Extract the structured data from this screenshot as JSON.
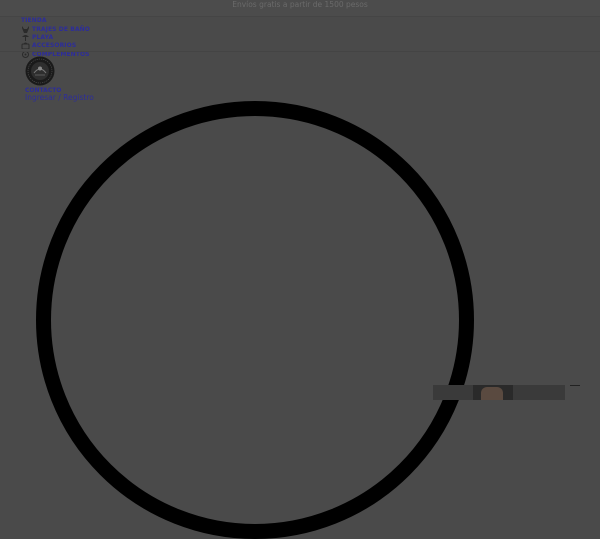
{
  "banner": {
    "text": "Envíos gratis a partir de 1500 pesos"
  },
  "nav": {
    "tienda": "TIENDA",
    "items": [
      {
        "label": "TRAJES DE BAÑO",
        "icon": "swimsuit-icon"
      },
      {
        "label": "PLAYA",
        "icon": "beach-icon"
      },
      {
        "label": "ACCESORIOS",
        "icon": "accessories-icon"
      },
      {
        "label": "COMPLEMENTOS",
        "icon": "complements-icon"
      }
    ],
    "contacto": "CONTACTO"
  },
  "account": {
    "login": "Ingresar",
    "separator": " / ",
    "register": "Registro"
  },
  "colors": {
    "overlay": "#4a4a4a",
    "link": "#2d2d9a",
    "spinner": "#000000"
  }
}
